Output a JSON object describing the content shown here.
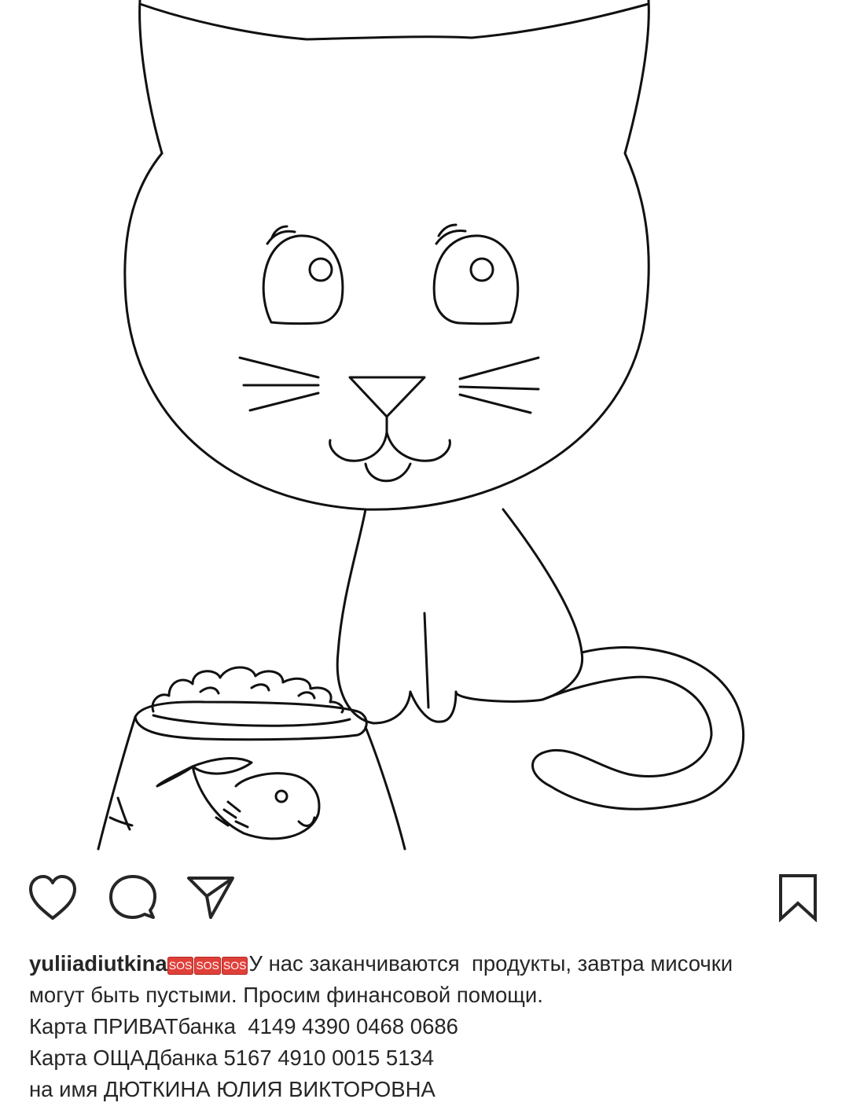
{
  "post": {
    "image": {
      "subject": "cat-with-food-bowl-drawing"
    },
    "actions": {
      "like_icon": "heart-outline-icon",
      "comment_icon": "speech-bubble-icon",
      "share_icon": "paper-plane-icon",
      "save_icon": "bookmark-outline-icon"
    },
    "caption": {
      "username": "yuliiadiutkina",
      "badges": [
        "SOS",
        "SOS",
        "SOS"
      ],
      "text_line1": "У нас заканчиваются  продукты, завтра мисочки",
      "text_line2": "могут быть пустыми. Просим финансовой помощи.",
      "text_line3": "Карта ПРИВАТбанка  4149 4390 0468 0686",
      "text_line4": "Карта ОЩАДбанка 5167 4910 0015 5134",
      "text_line5": "на имя ДЮТКИНА ЮЛИЯ ВИКТОРОВНА"
    }
  },
  "colors": {
    "text": "#262626",
    "sos_badge": "#e0403a",
    "line_art": "#111111"
  }
}
